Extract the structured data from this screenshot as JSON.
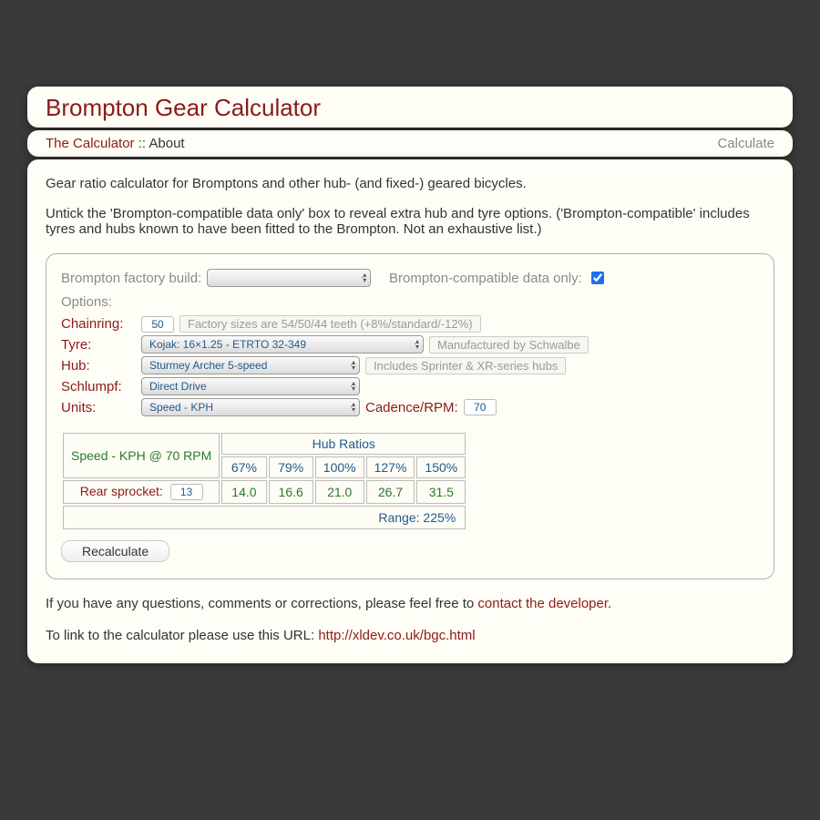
{
  "title": "Brompton Gear Calculator",
  "nav": {
    "calculator": "The Calculator",
    "sep": " :: ",
    "about": "About",
    "calculate": "Calculate"
  },
  "intro1": "Gear ratio calculator for Bromptons and other hub- (and fixed-) geared bicycles.",
  "intro2": "Untick the 'Brompton-compatible data only' box to reveal extra hub and tyre options. ('Brompton-compatible' includes tyres and hubs known to have been fitted to the Brompton. Not an exhaustive list.)",
  "form": {
    "build_label": "Brompton factory build:",
    "build_value": "",
    "compat_label": "Brompton-compatible data only:",
    "compat_checked": true,
    "options_label": "Options:",
    "chainring_label": "Chainring:",
    "chainring_value": "50",
    "chainring_desc": "Factory sizes are 54/50/44 teeth (+8%/standard/-12%)",
    "tyre_label": "Tyre:",
    "tyre_value": "Kojak: 16×1.25 - ETRTO 32-349",
    "tyre_desc": "Manufactured by Schwalbe",
    "hub_label": "Hub:",
    "hub_value": "Sturmey Archer 5-speed",
    "hub_desc": "Includes Sprinter & XR-series hubs",
    "schlumpf_label": "Schlumpf:",
    "schlumpf_value": "Direct Drive",
    "units_label": "Units:",
    "units_value": "Speed - KPH",
    "cadence_label": "Cadence/RPM:",
    "cadence_value": "70"
  },
  "results": {
    "header": "Speed - KPH @ 70 RPM",
    "hubratios_label": "Hub Ratios",
    "ratios": [
      "67%",
      "79%",
      "100%",
      "127%",
      "150%"
    ],
    "rear_label": "Rear sprocket:",
    "rear_value": "13",
    "speeds": [
      "14.0",
      "16.6",
      "21.0",
      "26.7",
      "31.5"
    ],
    "range": "Range: 225%",
    "recalc": "Recalculate"
  },
  "footer": {
    "contact_pre": "If you have any questions, comments or corrections, please feel free to ",
    "contact_link": "contact the developer",
    "contact_post": ".",
    "link_pre": "To link to the calculator please use this URL: ",
    "link_url": "http://xldev.co.uk/bgc.html"
  }
}
